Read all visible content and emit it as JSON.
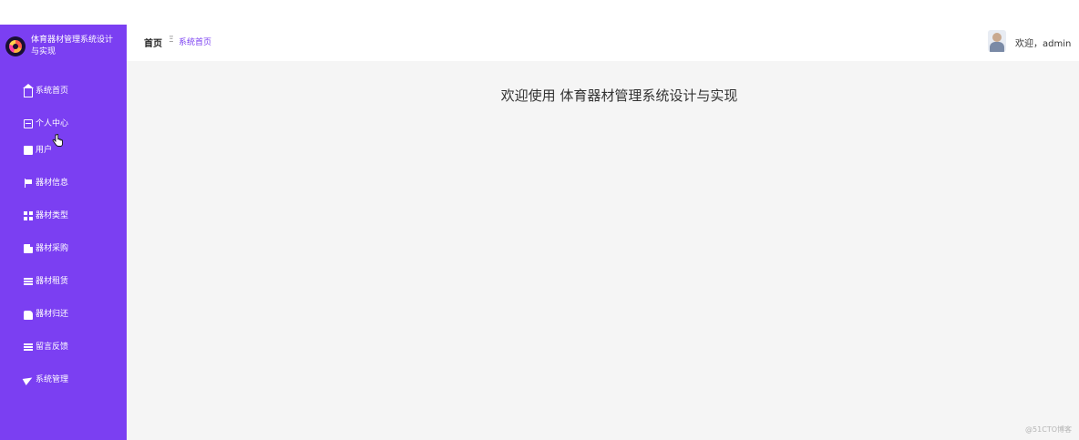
{
  "brand": {
    "title": "体育器材管理系统设计与实现"
  },
  "sidebar": {
    "items": [
      {
        "label": "系统首页",
        "icon": "home-icon"
      },
      {
        "label": "个人中心",
        "icon": "id-card-icon"
      },
      {
        "label": "用户",
        "icon": "user-icon"
      },
      {
        "label": "器材信息",
        "icon": "flag-icon"
      },
      {
        "label": "器材类型",
        "icon": "grid-icon"
      },
      {
        "label": "器材采购",
        "icon": "shopping-bag-icon"
      },
      {
        "label": "器材租赁",
        "icon": "list-icon"
      },
      {
        "label": "器材归还",
        "icon": "thumbs-up-icon"
      },
      {
        "label": "留言反馈",
        "icon": "list-icon"
      },
      {
        "label": "系统管理",
        "icon": "send-icon"
      }
    ]
  },
  "header": {
    "breadcrumb_home": "首页",
    "breadcrumb_separator": "Ξ",
    "breadcrumb_current": "系统首页",
    "welcome": "欢迎，admin"
  },
  "main": {
    "title": "欢迎使用 体育器材管理系统设计与实现"
  },
  "watermark": "@51CTO博客",
  "colors": {
    "sidebar_bg": "#7b3ff2",
    "main_bg": "#f5f5f5",
    "accent": "#7b3ff2"
  }
}
